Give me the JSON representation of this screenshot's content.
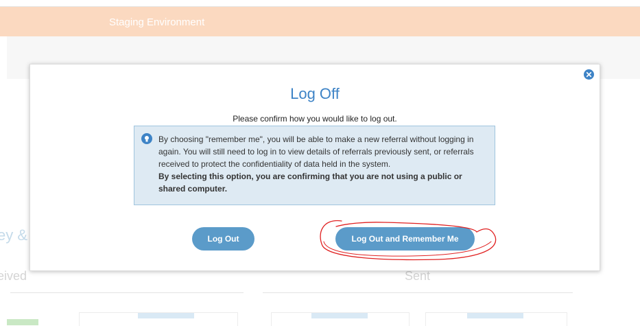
{
  "banner": {
    "text": "Staging Environment",
    "color": "#fbd9c0"
  },
  "background": {
    "section_title": "ey &",
    "received_label": "eived",
    "sent_label": "Sent"
  },
  "modal": {
    "title": "Log Off",
    "subtitle": "Please confirm how you would like to log out.",
    "info": {
      "icon": "lightbulb-icon",
      "text": "By choosing \"remember me\", you will be able to make a new referral without logging in again. You will still need to log in to view details of referrals previously sent, or referrals received to protect the confidentiality of data held in the system.",
      "bold_text": "By selecting this option, you are confirming that you are not using a public or shared computer."
    },
    "buttons": {
      "logout": "Log Out",
      "logout_remember": "Log Out and Remember Me"
    },
    "close_icon": "close-icon",
    "accent_color": "#3d83c6",
    "button_color": "#5b9bc9"
  },
  "annotation": {
    "color": "#e02020",
    "target": "logout_remember"
  }
}
